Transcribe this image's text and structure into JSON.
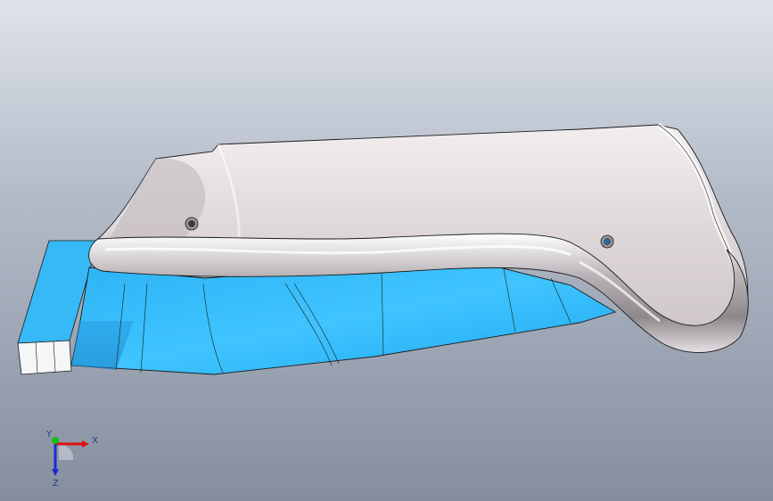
{
  "triad": {
    "x_label": "X",
    "y_label": "Y",
    "z_label": "Z"
  },
  "colors": {
    "background_top": "#dfe3ea",
    "background_bottom": "#858e9e",
    "handle_body": "#d9d3d5",
    "blade_blue": "#33bfff",
    "axis_x": "#e01010",
    "axis_y": "#10c010",
    "axis_z": "#1a2ad0"
  }
}
